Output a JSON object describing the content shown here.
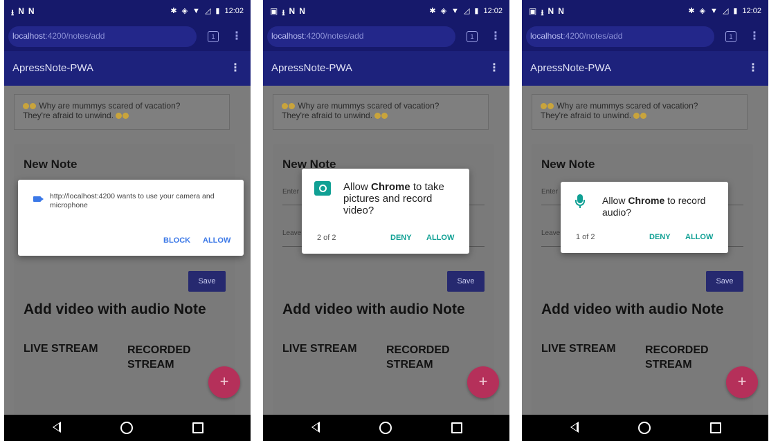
{
  "common": {
    "time": "12:02",
    "url_host": "localhost",
    "url_path": ":4200/notes/add",
    "tab_count": "1",
    "app_title": "ApressNote-PWA",
    "joke_line1": "Why are mummys scared of vacation?",
    "joke_line2": "They're afraid to unwind.",
    "new_note": "New Note",
    "enter_placeholder": "Enter",
    "leave_placeholder": "Leave",
    "save": "Save",
    "add_video": "Add video with audio Note",
    "live_stream": "LIVE STREAM",
    "recorded_line1": "RECORDED",
    "recorded_line2": "STREAM",
    "fab": "+"
  },
  "dialog1": {
    "message": "http://localhost:4200 wants to use your camera and microphone",
    "block": "BLOCK",
    "allow": "ALLOW"
  },
  "dialog2": {
    "prefix": "Allow ",
    "app": "Chrome",
    "suffix": " to take pictures and record video?",
    "count": "2 of 2",
    "deny": "DENY",
    "allow": "ALLOW"
  },
  "dialog3": {
    "prefix": "Allow ",
    "app": "Chrome",
    "suffix": " to record audio?",
    "count": "1 of 2",
    "deny": "DENY",
    "allow": "ALLOW"
  },
  "colors": {
    "appbar": "#1d227c",
    "teal": "#10a094",
    "blue": "#3b78e7",
    "fab": "#b5305a"
  }
}
